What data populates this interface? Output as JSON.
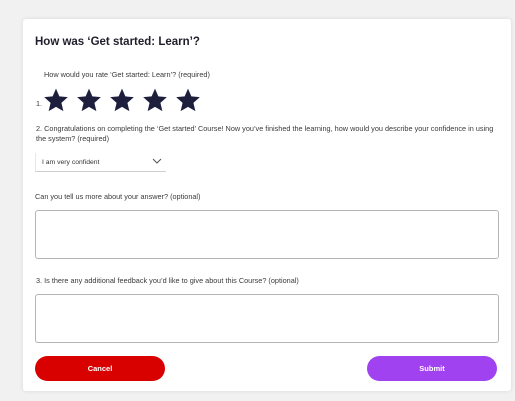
{
  "form": {
    "title": "How was ‘Get started: Learn’?",
    "q1": {
      "label": "How would you rate ‘Get started: Learn’? (required)",
      "number": "1.",
      "stars": 5
    },
    "q2": {
      "label": "2. Congratulations on completing the ‘Get started’ Course! Now you’ve finished the learning, how would you describe your confidence in using the system? (required)",
      "selected": "I am very confident"
    },
    "q2b": {
      "label": "Can you tell us more about your answer? (optional)",
      "value": ""
    },
    "q3": {
      "label": "3. Is there any additional feedback you’d like to give about this Course? (optional)",
      "value": ""
    },
    "buttons": {
      "cancel": "Cancel",
      "submit": "Submit"
    }
  },
  "colors": {
    "star": "#1d1f3d",
    "cancel": "#d90000",
    "submit": "#a142f0",
    "background": "#f1f1f1"
  },
  "icons": {
    "star": "star-icon",
    "chevron": "chevron-down-icon"
  }
}
